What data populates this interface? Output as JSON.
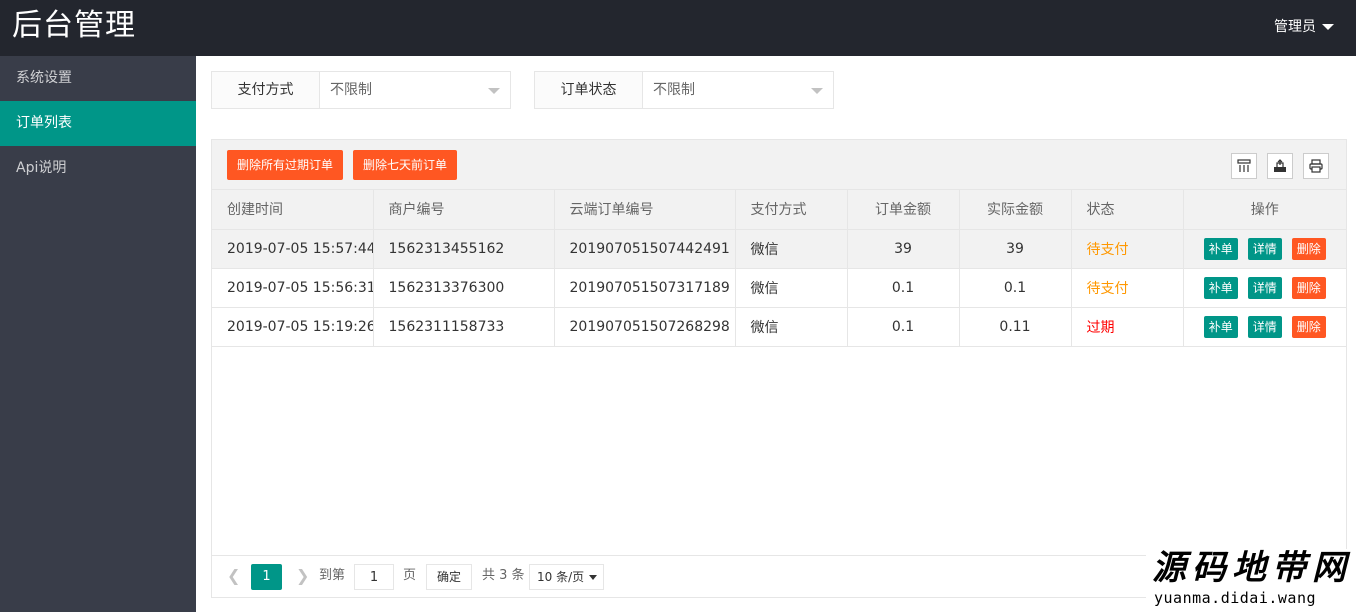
{
  "header": {
    "logo": "后台管理",
    "user": "管理员"
  },
  "sidebar": {
    "items": [
      {
        "label": "系统设置"
      },
      {
        "label": "订单列表"
      },
      {
        "label": "Api说明"
      }
    ]
  },
  "filters": {
    "pay_method": {
      "label": "支付方式",
      "value": "不限制"
    },
    "order_status": {
      "label": "订单状态",
      "value": "不限制"
    }
  },
  "toolbar": {
    "delete_expired": "删除所有过期订单",
    "delete_old": "删除七天前订单"
  },
  "table": {
    "columns": [
      "创建时间",
      "商户编号",
      "云端订单编号",
      "支付方式",
      "订单金额",
      "实际金额",
      "状态",
      "操作"
    ],
    "rows": [
      {
        "created": "2019-07-05 15:57:44",
        "merchant": "1562313455162",
        "cloud_no": "20190705150744249­1",
        "pay": "微信",
        "amount": "39",
        "actual": "39",
        "status": "待支付"
      },
      {
        "created": "2019-07-05 15:56:31",
        "merchant": "1562313376300",
        "cloud_no": "201907051507317189",
        "pay": "微信",
        "amount": "0.1",
        "actual": "0.1",
        "status": "待支付"
      },
      {
        "created": "2019-07-05 15:19:26",
        "merchant": "1562311158733",
        "cloud_no": "201907051507268298",
        "pay": "微信",
        "amount": "0.1",
        "actual": "0.11",
        "status": "过期"
      }
    ],
    "actions": {
      "fill": "补单",
      "detail": "详情",
      "delete": "删除"
    }
  },
  "pager": {
    "current": "1",
    "goto_label": "到第",
    "goto_value": "1",
    "page_unit": "页",
    "confirm": "确定",
    "total": "共 3 条",
    "page_size": "10 条/页"
  },
  "watermark": {
    "text": "源码地带网",
    "url": "yuanma.didai.wang"
  }
}
